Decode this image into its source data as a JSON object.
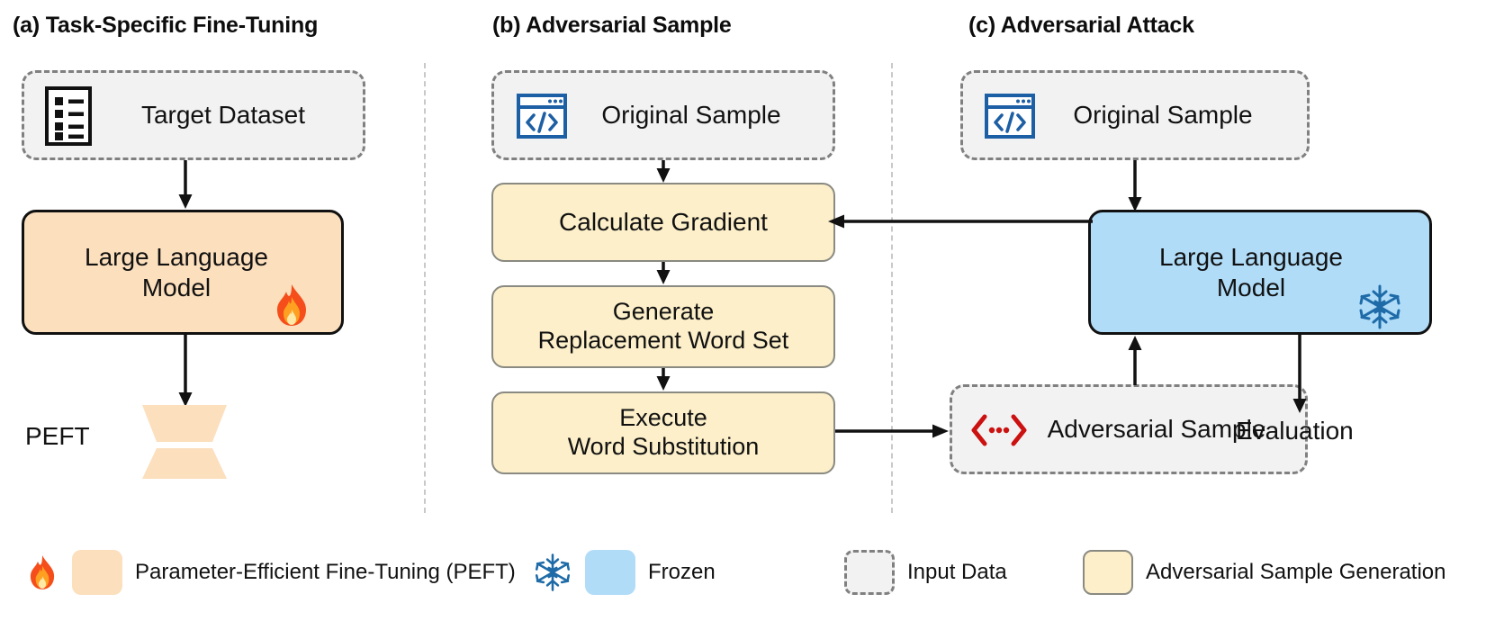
{
  "figure": {
    "panels": [
      {
        "id": "a",
        "title": "(a) Task-Specific Fine-Tuning"
      },
      {
        "id": "b",
        "title": "(b) Adversarial Sample"
      },
      {
        "id": "c",
        "title": "(c) Adversarial Attack"
      }
    ]
  },
  "panel_a": {
    "input_node": {
      "label": "Target  Dataset",
      "icon": "checklist-document-icon"
    },
    "model_node": {
      "label": "Large Language\nModel",
      "icon": "fire-emoji",
      "icon_char": "🔥"
    },
    "peft_label": "PEFT",
    "peft_icon": "hourglass-adapter-icon"
  },
  "panel_b": {
    "input_node": {
      "label": "Original Sample",
      "icon": "code-window-icon"
    },
    "steps": [
      {
        "label": "Calculate Gradient"
      },
      {
        "label": "Generate\nReplacement Word Set"
      },
      {
        "label": "Execute\nWord Substitution"
      }
    ]
  },
  "panel_c": {
    "input_node": {
      "label": "Original Sample",
      "icon": "code-window-icon"
    },
    "model_node": {
      "label": "Large Language\nModel",
      "icon": "snowflake-emoji",
      "icon_char": "❄"
    },
    "adversarial_node": {
      "label": "Adversarial Sample",
      "icon": "red-angle-bracket-icon"
    },
    "evaluation_label": "Evaluation"
  },
  "legend": {
    "items": [
      {
        "label": "Parameter-Efficient Fine-Tuning (PEFT)",
        "swatch": "orange",
        "icon": "fire-emoji",
        "icon_char": "🔥"
      },
      {
        "label": "Frozen",
        "swatch": "blue",
        "icon": "snowflake-emoji",
        "icon_char": "❄"
      },
      {
        "label": "Input Data",
        "swatch": "dashed",
        "icon": "",
        "icon_char": ""
      },
      {
        "label": "Adversarial Sample Generation",
        "swatch": "yellow",
        "icon": "",
        "icon_char": ""
      }
    ]
  },
  "colors": {
    "orange_fill": "#FCDFBD",
    "yellow_fill": "#FCEFC9",
    "blue_fill": "#B0DCF8",
    "dashed_fill": "#F2F2F2",
    "dashed_stroke": "#808080",
    "yellow_stroke": "#8A8A82",
    "icon_blue": "#1D5FA4",
    "icon_red": "#CC1111",
    "arrow": "#111111",
    "divider": "#C9C9C9"
  }
}
